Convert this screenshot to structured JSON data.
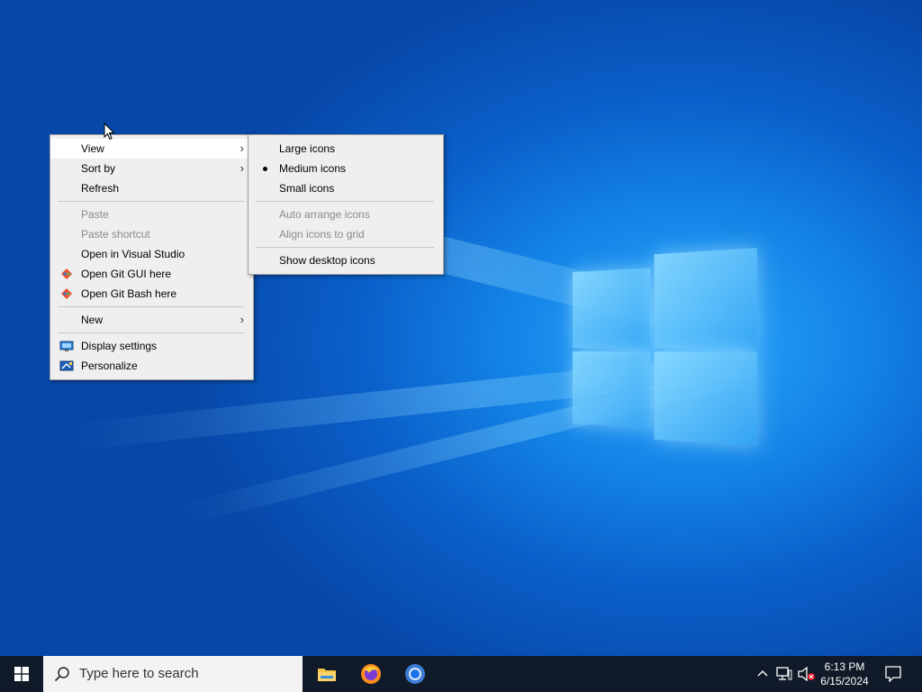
{
  "context_menu": {
    "items": [
      {
        "label": "View",
        "icon": "",
        "has_submenu": true,
        "disabled": false
      },
      {
        "label": "Sort by",
        "icon": "",
        "has_submenu": true,
        "disabled": false
      },
      {
        "label": "Refresh",
        "icon": "",
        "has_submenu": false,
        "disabled": false
      },
      {
        "label": "Paste",
        "icon": "",
        "has_submenu": false,
        "disabled": true
      },
      {
        "label": "Paste shortcut",
        "icon": "",
        "has_submenu": false,
        "disabled": true
      },
      {
        "label": "Open in Visual Studio",
        "icon": "",
        "has_submenu": false,
        "disabled": false
      },
      {
        "label": "Open Git GUI here",
        "icon": "git-icon",
        "has_submenu": false,
        "disabled": false
      },
      {
        "label": "Open Git Bash here",
        "icon": "git-icon",
        "has_submenu": false,
        "disabled": false
      },
      {
        "label": "New",
        "icon": "",
        "has_submenu": true,
        "disabled": false
      },
      {
        "label": "Display settings",
        "icon": "display-settings-icon",
        "has_submenu": false,
        "disabled": false
      },
      {
        "label": "Personalize",
        "icon": "personalize-icon",
        "has_submenu": false,
        "disabled": false
      }
    ]
  },
  "view_submenu": {
    "items": [
      {
        "label": "Large icons",
        "selected": false,
        "disabled": false
      },
      {
        "label": "Medium icons",
        "selected": true,
        "disabled": false
      },
      {
        "label": "Small icons",
        "selected": false,
        "disabled": false
      },
      {
        "label": "Auto arrange icons",
        "selected": false,
        "disabled": true
      },
      {
        "label": "Align icons to grid",
        "selected": false,
        "disabled": true
      },
      {
        "label": "Show desktop icons",
        "selected": false,
        "disabled": false
      }
    ]
  },
  "taskbar": {
    "search_placeholder": "Type here to search",
    "apps": [
      "file-explorer-icon",
      "firefox-icon",
      "chrome-icon"
    ],
    "clock": {
      "time": "6:13 PM",
      "date": "6/15/2024"
    }
  },
  "colors": {
    "menu_bg": "#efefef",
    "menu_active": "#ffffff",
    "taskbar_bg": "#101a28",
    "desktop_blue": "#1484e6"
  }
}
